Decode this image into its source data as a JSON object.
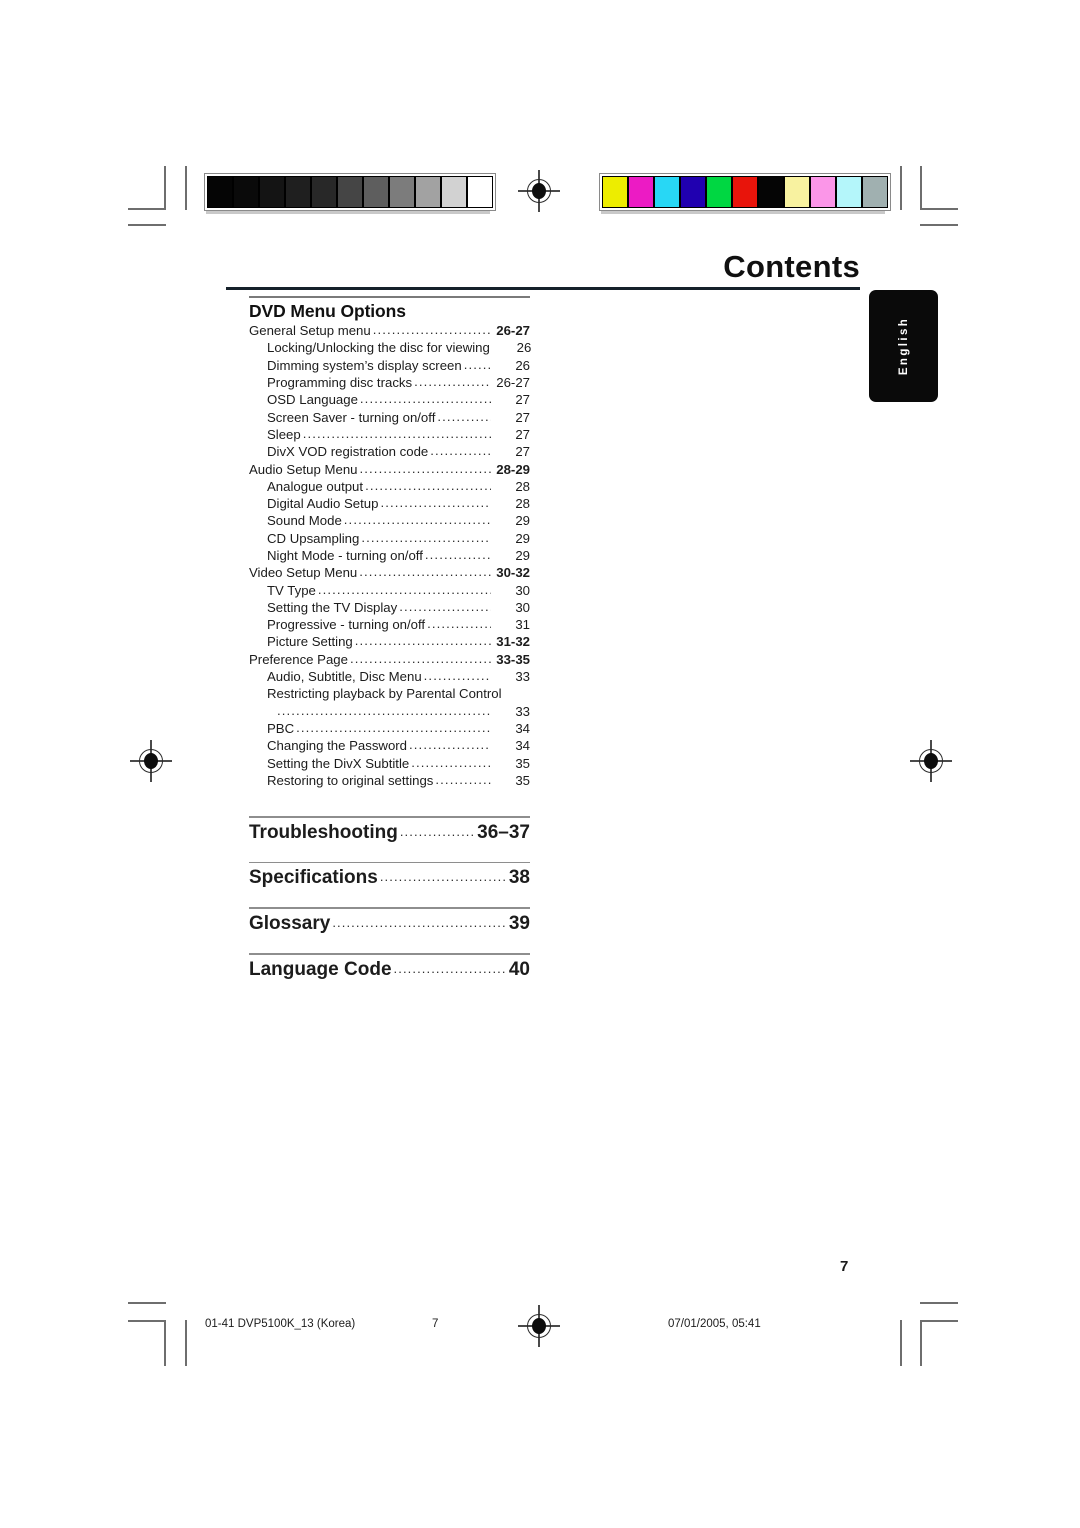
{
  "page": {
    "title": "Contents",
    "folio": "7"
  },
  "language_tab": {
    "label": "English"
  },
  "sections": [
    {
      "heading": "DVD Menu Options",
      "entries": [
        {
          "level": 1,
          "label": "General Setup menu",
          "page": "26-27"
        },
        {
          "level": 2,
          "label": "Locking/Unlocking the disc for viewing",
          "page": "26"
        },
        {
          "level": 2,
          "label": "Dimming system’s display screen",
          "page": "26"
        },
        {
          "level": 2,
          "label": "Programming disc tracks",
          "page": "26-27"
        },
        {
          "level": 2,
          "label": "OSD Language",
          "page": "27"
        },
        {
          "level": 2,
          "label": "Screen Saver - turning on/off",
          "page": "27"
        },
        {
          "level": 2,
          "label": "Sleep",
          "page": "27"
        },
        {
          "level": 2,
          "label": "DivX VOD registration code",
          "page": "27"
        },
        {
          "level": 1,
          "label": "Audio Setup Menu",
          "page": "28-29"
        },
        {
          "level": 2,
          "label": "Analogue output",
          "page": "28"
        },
        {
          "level": 2,
          "label": "Digital Audio Setup",
          "page": "28"
        },
        {
          "level": 2,
          "label": "Sound Mode",
          "page": "29"
        },
        {
          "level": 2,
          "label": "CD Upsampling",
          "page": "29"
        },
        {
          "level": 2,
          "label": "Night Mode - turning on/off",
          "page": "29"
        },
        {
          "level": 1,
          "label": "Video Setup Menu",
          "page": "30-32"
        },
        {
          "level": 2,
          "label": "TV Type",
          "page": "30"
        },
        {
          "level": 2,
          "label": "Setting the TV Display",
          "page": "30"
        },
        {
          "level": 2,
          "label": "Progressive - turning on/off",
          "page": "31"
        },
        {
          "level": 2,
          "label": "Picture Setting",
          "page": "31-32",
          "bold_page": true
        },
        {
          "level": 1,
          "label": "Preference Page",
          "page": "33-35"
        },
        {
          "level": 2,
          "label": "Audio, Subtitle, Disc Menu",
          "page": "33"
        },
        {
          "level": 2,
          "label": "Restricting playback by Parental Control",
          "page": "",
          "wrapped": true
        },
        {
          "level": 2,
          "label": "",
          "page": "33",
          "continuation": true
        },
        {
          "level": 2,
          "label": "PBC",
          "page": "34"
        },
        {
          "level": 2,
          "label": "Changing the Password",
          "page": "34"
        },
        {
          "level": 2,
          "label": "Setting the DivX Subtitle",
          "page": "35"
        },
        {
          "level": 2,
          "label": "Restoring to original settings",
          "page": "35"
        }
      ]
    }
  ],
  "big_sections": [
    {
      "label": "Troubleshooting",
      "page": "36–37"
    },
    {
      "label": "Specifications",
      "page": "38"
    },
    {
      "label": "Glossary",
      "page": "39"
    },
    {
      "label": "Language Code",
      "page": "40"
    }
  ],
  "footer": {
    "file": "01-41 DVP5100K_13 (Korea)",
    "page": "7",
    "date": "07/01/2005, 05:41"
  },
  "calibration": {
    "grayscale": [
      "#050505",
      "#0a0a0a",
      "#141414",
      "#1f1f1f",
      "#282828",
      "#454545",
      "#5e5e5e",
      "#7c7c7c",
      "#a2a2a2",
      "#d2d2d2",
      "#ffffff"
    ],
    "colors": [
      "#eded00",
      "#ec1bc4",
      "#28d7f5",
      "#2000b0",
      "#00d742",
      "#e8140b",
      "#050505",
      "#f8f2a0",
      "#fb96e8",
      "#b4f6fa",
      "#a0b0b0"
    ]
  },
  "leader_dots": "......................................................................................................................."
}
